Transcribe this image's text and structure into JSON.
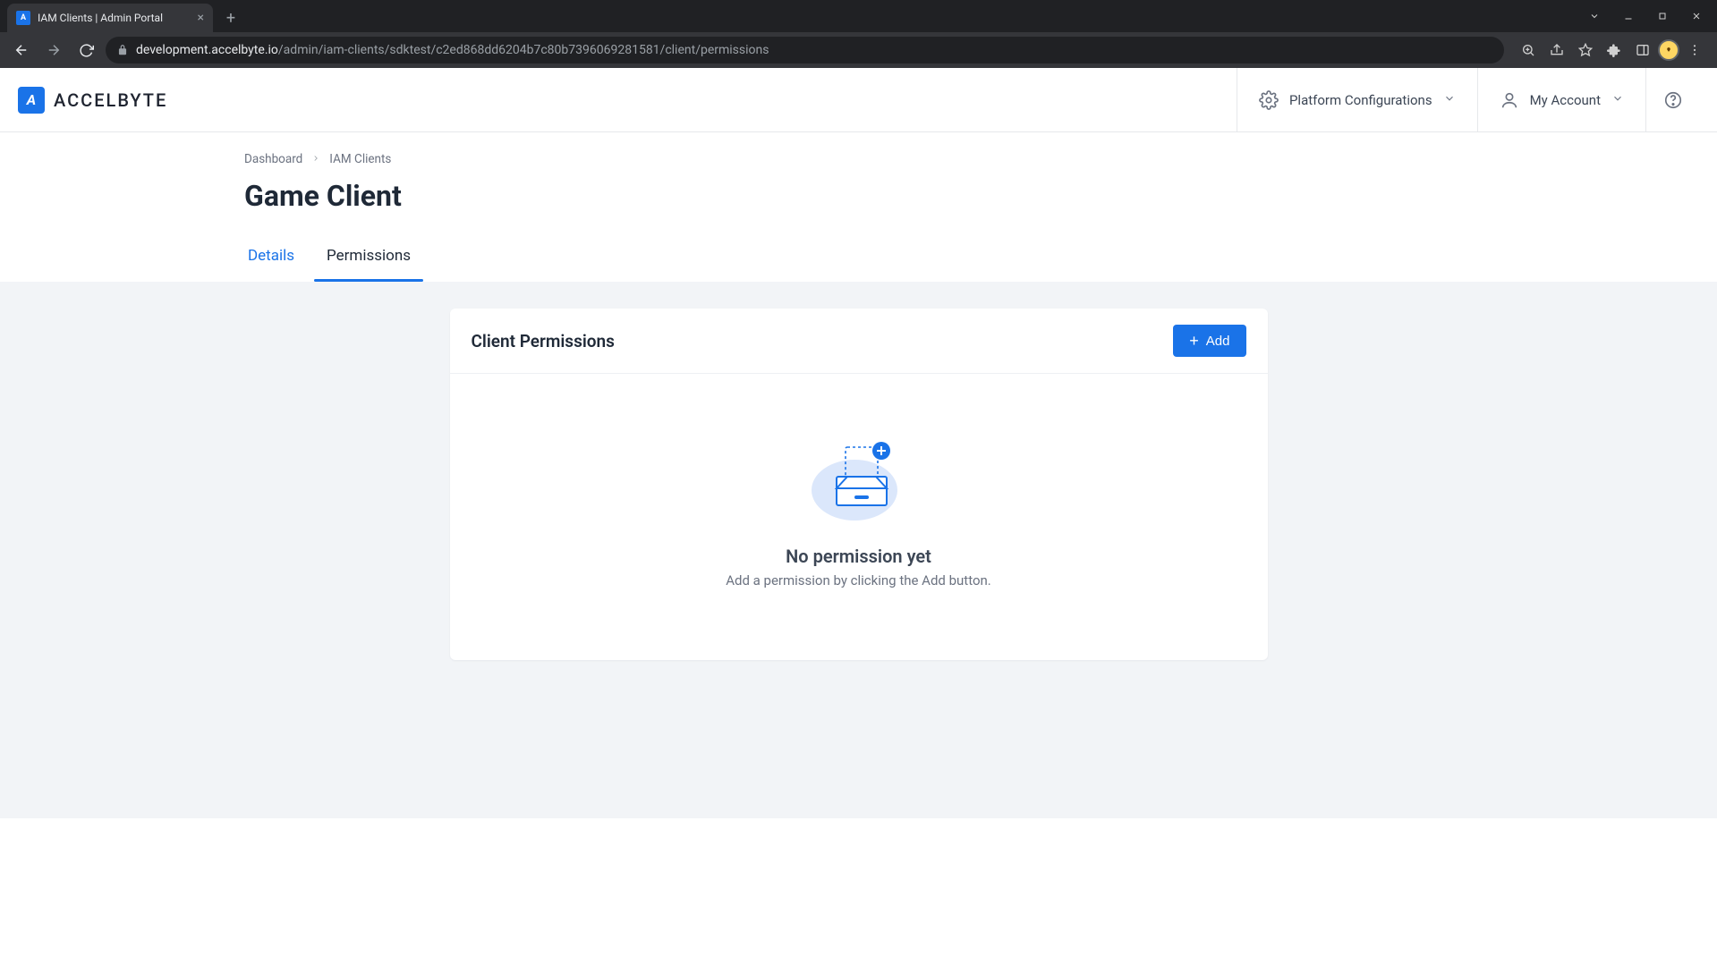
{
  "browser": {
    "tab_title": "IAM Clients | Admin Portal",
    "url_host": "development.accelbyte.io",
    "url_path": "/admin/iam-clients/sdktest/c2ed868dd6204b7c80b7396069281581/client/permissions"
  },
  "header": {
    "logo_text": "ACCELBYTE",
    "platform_config_label": "Platform Configurations",
    "account_label": "My Account"
  },
  "breadcrumb": {
    "items": [
      "Dashboard",
      "IAM Clients"
    ]
  },
  "page_title": "Game Client",
  "tabs": {
    "items": [
      {
        "label": "Details",
        "active": false
      },
      {
        "label": "Permissions",
        "active": true
      }
    ]
  },
  "panel": {
    "title": "Client Permissions",
    "add_label": "Add",
    "empty_title": "No permission yet",
    "empty_subtitle": "Add a permission by clicking the Add button."
  },
  "colors": {
    "primary": "#1a73e8",
    "page_bg": "#f2f4f7",
    "text_primary": "#1f2937",
    "text_secondary": "#6b7280"
  }
}
